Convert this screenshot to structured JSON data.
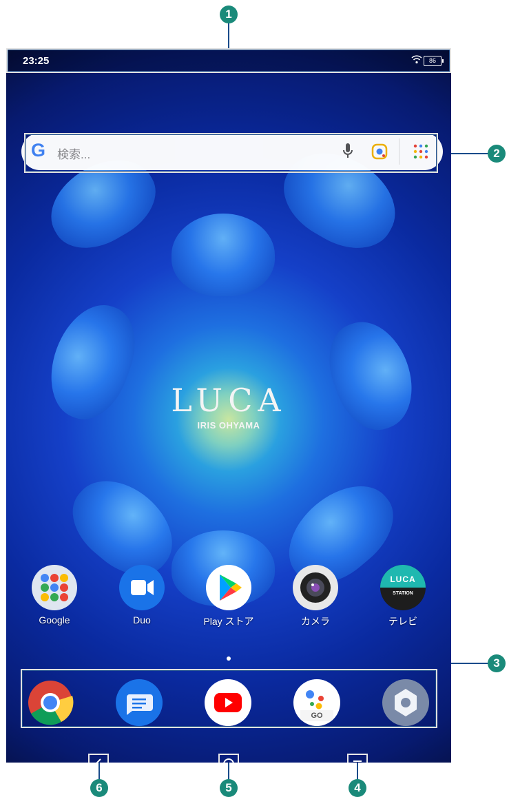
{
  "status": {
    "time": "23:25",
    "battery": "86"
  },
  "search": {
    "placeholder": "検索..."
  },
  "brand": {
    "name": "LUCA",
    "sub": "IRIS OHYAMA"
  },
  "apps": [
    {
      "label": "Google",
      "icon": "google-folder-icon"
    },
    {
      "label": "Duo",
      "icon": "duo-icon"
    },
    {
      "label": "Play ストア",
      "icon": "play-store-icon"
    },
    {
      "label": "カメラ",
      "icon": "camera-icon"
    },
    {
      "label": "テレビ",
      "icon": "luca-station-icon",
      "badge_top": "LUCA",
      "badge_bottom": "STATION"
    }
  ],
  "dock": [
    {
      "icon": "chrome-icon"
    },
    {
      "icon": "messages-icon"
    },
    {
      "icon": "youtube-icon"
    },
    {
      "icon": "assistant-go-icon",
      "text": "GO"
    },
    {
      "icon": "settings-icon"
    }
  ],
  "nav": [
    {
      "icon": "back-icon"
    },
    {
      "icon": "home-icon"
    },
    {
      "icon": "recents-icon"
    }
  ],
  "callouts": [
    "1",
    "2",
    "3",
    "4",
    "5",
    "6"
  ],
  "colors": {
    "callout": "#1a8a7a",
    "frame": "#1a4b8a"
  }
}
